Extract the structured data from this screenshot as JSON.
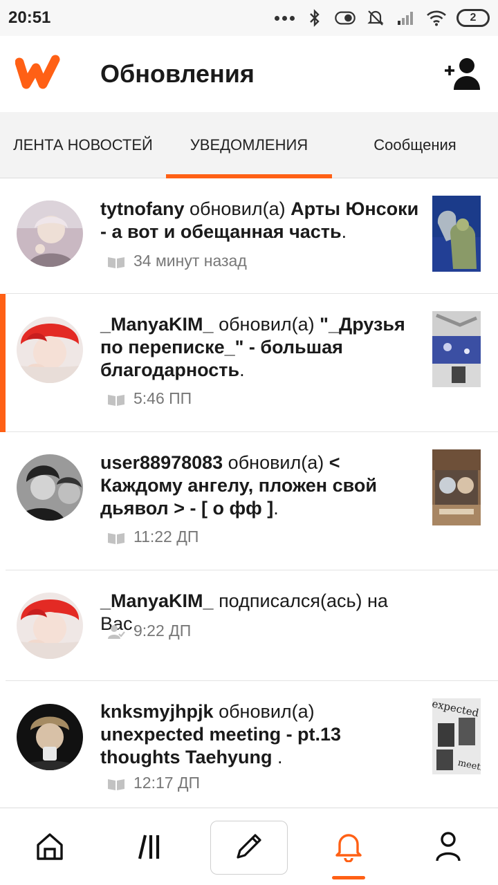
{
  "status_bar": {
    "time": "20:51",
    "battery": "2",
    "icons": [
      "dots-icon",
      "bluetooth-icon",
      "toggle-icon",
      "bell-muted-icon",
      "signal-icon",
      "wifi-icon",
      "battery-icon"
    ]
  },
  "app_bar": {
    "title": "Обновления",
    "logo": "wattpad-logo",
    "action_icon": "add-user-icon"
  },
  "tabs": [
    {
      "label": "ЛЕНТА НОВОСТЕЙ",
      "active": false
    },
    {
      "label": "УВЕДОМЛЕНИЯ",
      "active": true
    },
    {
      "label": "Сообщения",
      "active": false
    }
  ],
  "notifications": [
    {
      "user": "tytnofany",
      "action": " обновил(а) ",
      "story": "Арты Юнсоки - а вот и обещанная часть",
      "tail": ".",
      "time": "34 минут назад",
      "icon": "book-icon",
      "unread": false
    },
    {
      "user": "_ManyaKIM_",
      "action": " обновил(а) ",
      "story": "\"_Друзья по переписке_\" - большая благодарность",
      "tail": ".",
      "time": "5:46 ПП",
      "icon": "book-icon",
      "unread": true
    },
    {
      "user": "user88978083",
      "action": " обновил(а) ",
      "story": "< Каждому ангелу, пложен свой дьявол > - [ о фф ]",
      "tail": ".",
      "time": "11:22 ДП",
      "icon": "book-icon",
      "unread": false
    },
    {
      "user": "_ManyaKIM_",
      "action": " подписался(ась) на Вас.",
      "story": "",
      "tail": "",
      "time": "9:22 ДП",
      "icon": "follow-icon",
      "unread": false
    },
    {
      "user": "knksmyjhpjk",
      "action": " обновил(а) ",
      "story": "unexpected meeting - pt.13 thoughts Taehyung",
      "tail": " .",
      "time": "12:17 ДП",
      "icon": "book-icon",
      "unread": false
    }
  ],
  "thumb_text": {
    "top": "expected",
    "bottom": "meetin"
  },
  "bottom_nav": [
    {
      "name": "home",
      "icon": "home-icon"
    },
    {
      "name": "library",
      "icon": "library-icon"
    },
    {
      "name": "write",
      "icon": "pencil-icon"
    },
    {
      "name": "notifications",
      "icon": "bell-icon",
      "active": true
    },
    {
      "name": "profile",
      "icon": "profile-icon"
    }
  ],
  "colors": {
    "accent": "#ff6015",
    "text": "#1a1a1a",
    "muted": "#777777"
  }
}
